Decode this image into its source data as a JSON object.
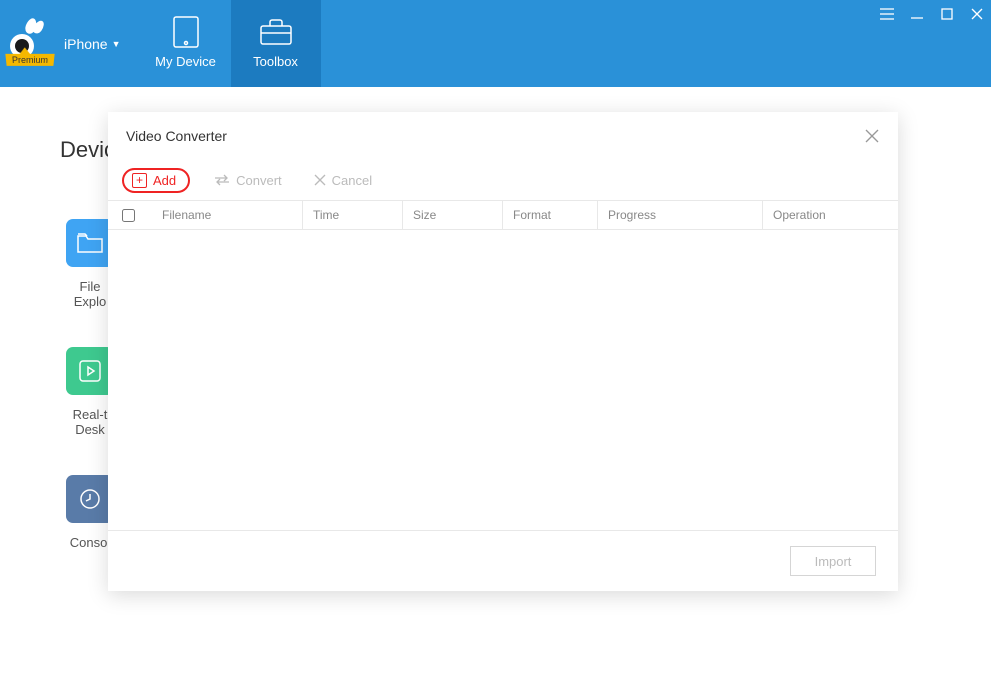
{
  "header": {
    "premium_label": "Premium",
    "device_name": "iPhone",
    "tabs": [
      {
        "label": "My Device",
        "icon": "tablet-icon"
      },
      {
        "label": "Toolbox",
        "icon": "toolbox-icon"
      }
    ]
  },
  "bg": {
    "heading": "Devic",
    "tools": [
      {
        "label_line1": "File",
        "label_line2": "Explo",
        "icon": "folder-icon"
      },
      {
        "label_line1": "Real-t",
        "label_line2": "Desk",
        "icon": "play-icon"
      },
      {
        "label_line1": "Consol",
        "label_line2": "",
        "icon": "clock-icon"
      }
    ]
  },
  "modal": {
    "title": "Video Converter",
    "toolbar": {
      "add_label": "Add",
      "convert_label": "Convert",
      "cancel_label": "Cancel"
    },
    "columns": {
      "filename": "Filename",
      "time": "Time",
      "size": "Size",
      "format": "Format",
      "progress": "Progress",
      "operation": "Operation"
    },
    "footer": {
      "import_label": "Import"
    }
  }
}
